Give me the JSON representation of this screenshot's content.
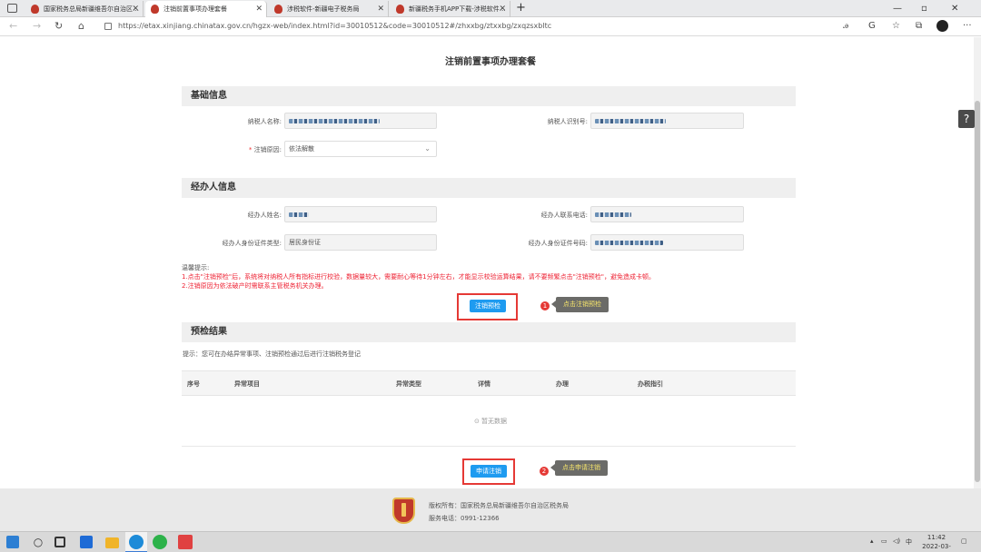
{
  "browser": {
    "tabs": [
      {
        "label": "国家税务总局新疆维吾尔自治区…",
        "active": false
      },
      {
        "label": "注销前置事项办理套餐",
        "active": true
      },
      {
        "label": "涉税软件-新疆电子税务局",
        "active": false
      },
      {
        "label": "新疆税务手机APP下载-涉税软件…",
        "active": false
      }
    ],
    "new_tab": "+",
    "url": "https://etax.xinjiang.chinatax.gov.cn/hgzx-web/index.html?id=30010512&code=30010512#/zhxxbg/ztxxbg/zxqzsxbltc"
  },
  "page": {
    "title": "注销前置事项办理套餐",
    "help_icon": "?",
    "basic": {
      "header": "基础信息",
      "taxpayer_name_label": "纳税人名称:",
      "taxpayer_id_label": "纳税人识别号:",
      "reason_label": "注销原因:",
      "reason_value": "依法解散",
      "reason_required": "*"
    },
    "agent": {
      "header": "经办人信息",
      "name_label": "经办人姓名:",
      "phone_label": "经办人联系电话:",
      "idtype_label": "经办人身份证件类型:",
      "idtype_value": "居民身份证",
      "idno_label": "经办人身份证件号码:"
    },
    "warm_tips": {
      "title": "温馨提示:",
      "line1": "1.点击\"注销预检\"后，系统将对纳税人所有指标进行校验，数据量较大，需要耐心等待1分钟左右，才能显示校验运算结果，请不要频繁点击\"注销预检\"，避免造成卡顿。",
      "line2": "2.注销原因为依法破产时需联系主管税务机关办理。"
    },
    "precheck_button": "注销预检",
    "callout1": {
      "num": "1",
      "text": "点击注销预检"
    },
    "result": {
      "header": "预检结果",
      "hint": "提示：您可在办结异常事项、注销预检通过后进行注销税务登记",
      "columns": [
        "序号",
        "异常项目",
        "异常类型",
        "详情",
        "办理",
        "办税指引"
      ],
      "empty": "⊙ 暂无数据"
    },
    "apply_button": "申请注销",
    "callout2": {
      "num": "2",
      "text": "点击申请注销"
    }
  },
  "footer": {
    "copyright": "版权所有：国家税务总局新疆维吾尔自治区税务局",
    "phone": "服务电话：0991-12366"
  },
  "taskbar": {
    "ime": "中",
    "time": "11:42",
    "date": "2022-03-15"
  }
}
